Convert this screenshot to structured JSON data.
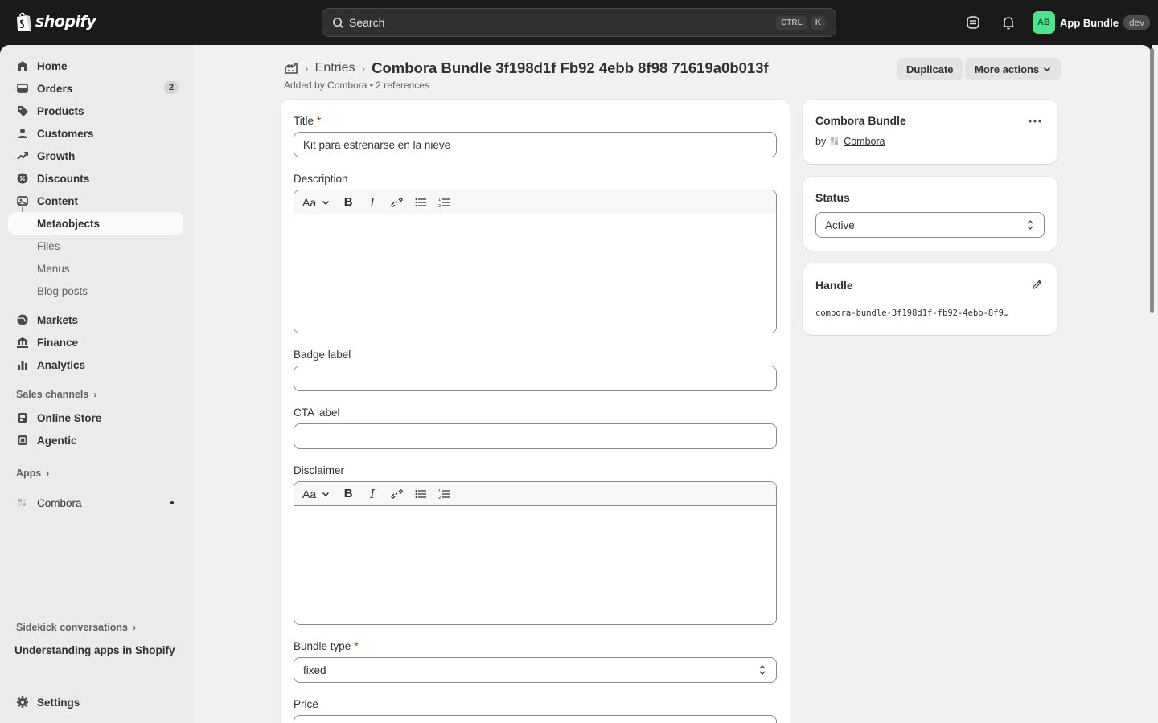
{
  "topbar": {
    "logo_text": "shopify",
    "search_placeholder": "Search",
    "shortcut_keys": [
      "CTRL",
      "K"
    ],
    "account_initials": "AB",
    "account_name": "App Bundle",
    "account_badge": "dev"
  },
  "sidebar": {
    "items": [
      {
        "label": "Home",
        "icon": "home-icon"
      },
      {
        "label": "Orders",
        "icon": "orders-icon",
        "badge": "2"
      },
      {
        "label": "Products",
        "icon": "tag-icon"
      },
      {
        "label": "Customers",
        "icon": "person-icon"
      },
      {
        "label": "Growth",
        "icon": "growth-icon"
      },
      {
        "label": "Discounts",
        "icon": "discount-icon"
      },
      {
        "label": "Content",
        "icon": "content-icon"
      }
    ],
    "content_sub": [
      "Metaobjects",
      "Files",
      "Menus",
      "Blog posts"
    ],
    "items2": [
      {
        "label": "Markets",
        "icon": "globe-icon"
      },
      {
        "label": "Finance",
        "icon": "bank-icon"
      },
      {
        "label": "Analytics",
        "icon": "chart-icon"
      }
    ],
    "sales_channels_label": "Sales channels",
    "channels": [
      "Online Store",
      "Agentic"
    ],
    "apps_label": "Apps",
    "apps": [
      "Combora"
    ],
    "sidekick_label": "Sidekick conversations",
    "sidekick_item": "Understanding apps in Shopify",
    "settings_label": "Settings"
  },
  "page": {
    "breadcrumb_link": "Entries",
    "title": "Combora Bundle 3f198d1f Fb92 4ebb 8f98 71619a0b013f",
    "subtitle": "Added by Combora • 2 references",
    "duplicate_label": "Duplicate",
    "more_actions_label": "More actions"
  },
  "form": {
    "title_label": "Title",
    "title_value": "Kit para estrenarse en la nieve",
    "description_label": "Description",
    "badge_label": "Badge label",
    "badge_value": "",
    "cta_label": "CTA label",
    "cta_value": "",
    "disclaimer_label": "Disclaimer",
    "bundle_type_label": "Bundle type",
    "bundle_type_value": "fixed",
    "price_label": "Price",
    "rte_format_label": "Aa"
  },
  "app_card": {
    "title": "Combora Bundle",
    "by_label": "by",
    "app_link": "Combora"
  },
  "status_card": {
    "title": "Status",
    "value": "Active"
  },
  "handle_card": {
    "title": "Handle",
    "value": "combora-bundle-3f198d1f-fb92-4ebb-8f9…"
  }
}
